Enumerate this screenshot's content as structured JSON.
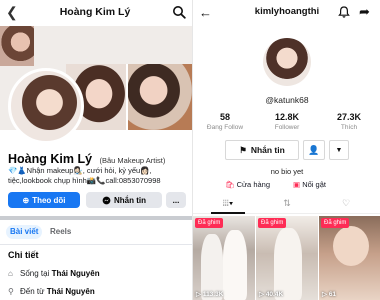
{
  "facebook": {
    "header_title": "Hoàng Kim Lý",
    "profile_name": "Hoàng Kim Lý",
    "alternate_name": "(Bâu Makeup Artist)",
    "bio": "💎👗Nhận makeup👩🏻‍🎨, cưới hỏi, kỷ yếu👩🏻, tiệc,lookbook chụp hình📸📞call:0853070998",
    "follow_button": "Theo dõi",
    "message_button": "Nhắn tin",
    "more_button": "...",
    "tabs": [
      {
        "label": "Bài viết",
        "active": true
      },
      {
        "label": "Reels",
        "active": false
      }
    ],
    "details_heading": "Chi tiết",
    "details": [
      {
        "prefix": "Sống tại ",
        "place": "Thái Nguyên"
      },
      {
        "prefix": "Đến từ ",
        "place": "Thái Nguyên"
      }
    ],
    "accent_color": "#1877f2"
  },
  "tiktok": {
    "header_title": "kimlyhoangthi",
    "handle": "@katunk68",
    "stats": [
      {
        "value": "58",
        "label": "Đang Follow"
      },
      {
        "value": "12.8K",
        "label": "Follower"
      },
      {
        "value": "27.3K",
        "label": "Thích"
      }
    ],
    "message_button": "Nhắn tin",
    "bio": "no bio yet",
    "links": [
      {
        "label": "Cửa hàng"
      },
      {
        "label": "Nổi gật"
      }
    ],
    "videos": [
      {
        "pinned_label": "Đã ghim",
        "views": "113.3K"
      },
      {
        "pinned_label": "Đã ghim",
        "views": "40.4K"
      },
      {
        "pinned_label": "Đã ghim",
        "views": "61"
      }
    ],
    "accent_color": "#fe2c55"
  }
}
